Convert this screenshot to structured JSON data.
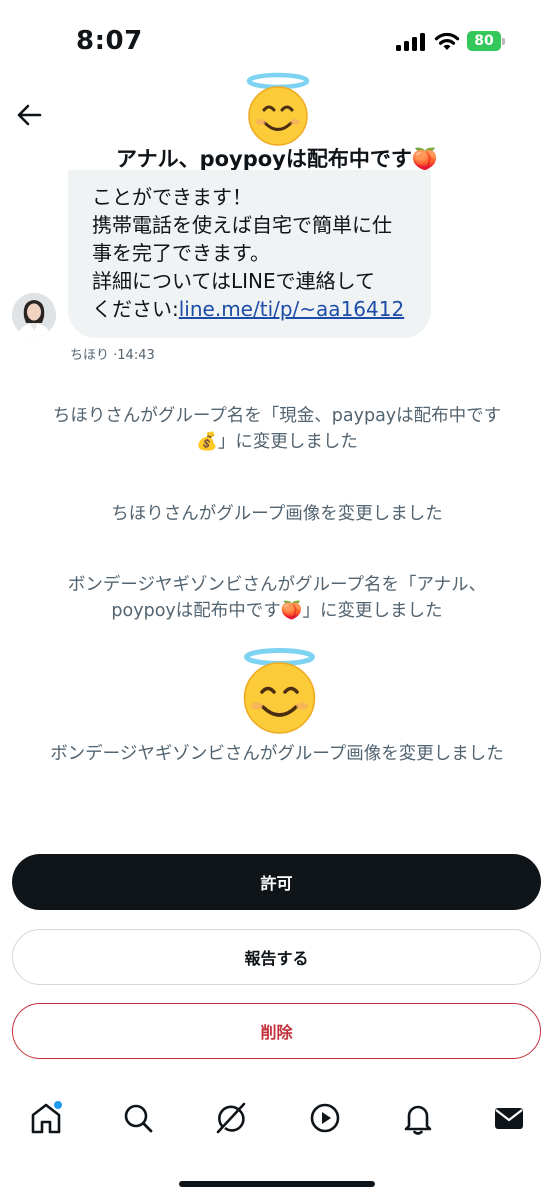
{
  "status_bar": {
    "time": "8:07",
    "battery": "80",
    "battery_color": "#34c759"
  },
  "header": {
    "title": "アナル、poypoyは配布中です🍑",
    "emoji": "smiling-face-with-halo"
  },
  "message": {
    "lines": [
      "ことができます！",
      "携帯電話を使えば自宅で簡単に仕",
      "事を完了できます。",
      "詳細についてはLINEで連絡して"
    ],
    "last_line_prefix": "ください:",
    "link": "line.me/ti/p/~aa16412",
    "sender": "ちほり",
    "time": "·14:43"
  },
  "events": [
    {
      "line1": "ちほりさんがグループ名を「現金、paypayは配布中です",
      "line2": "💰」に変更しました"
    },
    {
      "line1": "ちほりさんがグループ画像を変更しました"
    },
    {
      "line1": "ボンデージヤギゾンビさんがグループ名を「アナル、",
      "line2": "poypoyは配布中です🍑」に変更しました"
    },
    {
      "line1": "ボンデージヤギゾンビさんがグループ画像を変更しました"
    }
  ],
  "actions": {
    "allow": "許可",
    "report": "報告する",
    "delete": "削除"
  },
  "colors": {
    "delete": "#c4313b",
    "link": "#1d4ca8",
    "notification_dot": "#1d9bf0"
  },
  "tabs": [
    "home-icon",
    "search-icon",
    "grok-icon",
    "video-icon",
    "notifications-icon",
    "messages-icon"
  ]
}
